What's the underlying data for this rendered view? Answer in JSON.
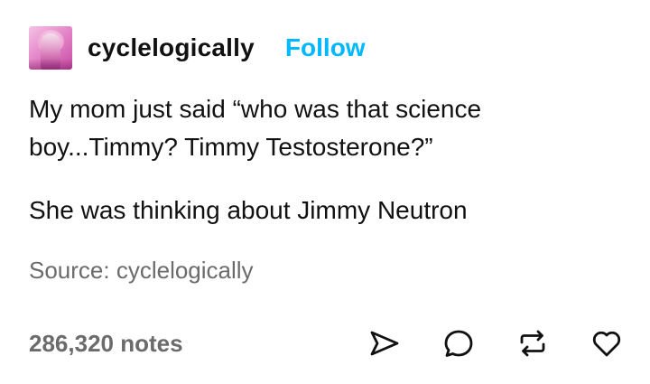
{
  "post": {
    "author": {
      "username": "cyclelogically",
      "follow_label": "Follow"
    },
    "body": {
      "paragraph1": "My mom just said “who was that science boy...Timmy? Timmy Testosterone?”",
      "paragraph2": "She was thinking about Jimmy Neutron"
    },
    "source": {
      "prefix": "Source: ",
      "name": "cyclelogically"
    },
    "footer": {
      "notes": "286,320 notes",
      "actions": [
        "share-icon",
        "reply-icon",
        "reblog-icon",
        "like-icon"
      ]
    }
  },
  "colors": {
    "accent": "#00b8ff",
    "text": "#111111",
    "muted": "#6b6b6b"
  }
}
